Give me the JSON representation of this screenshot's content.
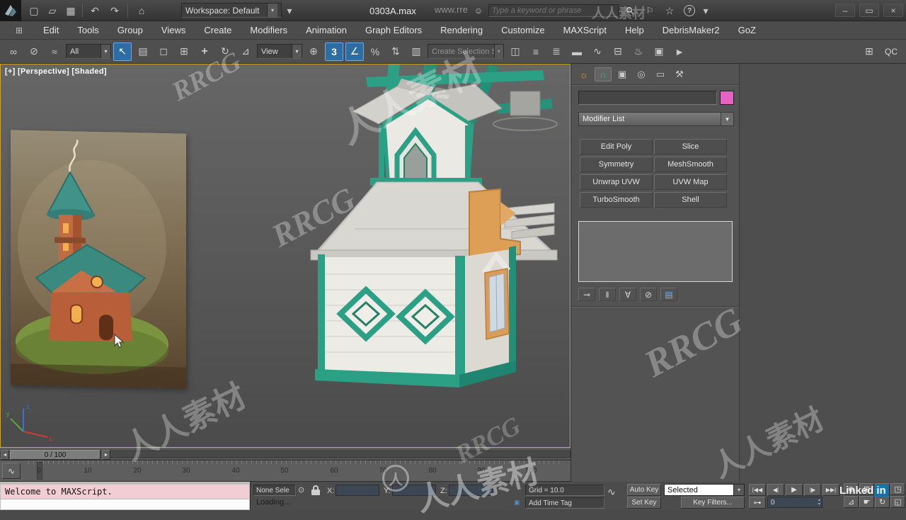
{
  "titlebar": {
    "workspace": "Workspace: Default",
    "document": "0303A.max",
    "search_placeholder": "Type a keyword or phrase"
  },
  "menus": [
    "Edit",
    "Tools",
    "Group",
    "Views",
    "Create",
    "Modifiers",
    "Animation",
    "Graph Editors",
    "Rendering",
    "Customize",
    "MAXScript",
    "Help",
    "DebrisMaker2",
    "GoZ"
  ],
  "toolbar": {
    "selection_filter": "All",
    "coord_system": "View",
    "named_selection": "Create Selection S",
    "qc": "QC"
  },
  "viewport": {
    "label": "[+] [Perspective] [Shaded]"
  },
  "command_panel": {
    "modifier_list": "Modifier List",
    "buttons": [
      "Edit Poly",
      "Slice",
      "Symmetry",
      "MeshSmooth",
      "Unwrap UVW",
      "UVW Map",
      "TurboSmooth",
      "Shell"
    ],
    "object_color": "#e562c5"
  },
  "timeline": {
    "slider": "0 / 100",
    "ticks": [
      "0",
      "10",
      "20",
      "30",
      "40",
      "50",
      "60",
      "70",
      "80",
      "90",
      "100"
    ]
  },
  "statusbar": {
    "listener_line": "Welcome to MAXScript.",
    "prompt": "Loading...",
    "selection": "None Sele",
    "x_label": "X:",
    "y_label": "Y:",
    "z_label": "Z:",
    "grid": "Grid = 10.0",
    "time_tag": "Add Time Tag",
    "auto_key": "Auto Key",
    "set_key": "Set Key",
    "key_mode": "Selected",
    "key_filters": "Key Filters...",
    "frame": "0"
  },
  "watermarks": {
    "brand_cn": "人人素材",
    "brand_en": "RRCG",
    "url": "www.rre",
    "linked": "Linked",
    "linked_in": "in",
    "circle_char": "人"
  },
  "icons": {
    "new_doc": "▢",
    "open_file": "▱",
    "save": "▦",
    "undo": "↶",
    "redo": "↷",
    "project": "⌂",
    "dropdown": "▾",
    "user": "☺",
    "search": "⚲",
    "flag": "⚐",
    "star": "☆",
    "help": "?",
    "minimize": "–",
    "maximize": "▭",
    "close": "×",
    "select_link": "∞",
    "unlink": "⊘",
    "bind": "≈",
    "select": "↖",
    "select_name": "▤",
    "rect_region": "◻",
    "crossing": "⊞",
    "move": "+",
    "rotate": "↻",
    "scale": "⊿",
    "manipulate": "⊕",
    "snap3": "3",
    "angle_snap": "∠",
    "percent_snap": "%",
    "spinner_snap": "⇅",
    "named_sets": "▥",
    "mirror": "◫",
    "align": "≡",
    "layers": "≣",
    "ribbon": "▬",
    "curve": "∿",
    "schematic": "⊟",
    "teapot": "♨",
    "frame_win": "▣",
    "render": "►",
    "pipeline": "⊞",
    "cp_create": "☼",
    "cp_modify": "∩",
    "cp_hierarchy": "▣",
    "cp_motion": "◎",
    "cp_display": "▭",
    "cp_utilities": "⚒",
    "pin_stack": "⊸",
    "end_result": "‖",
    "make_unique": "∀",
    "remove_mod": "⊘",
    "config_sets": "▤",
    "status_pin": "⊙",
    "tangent": "∿",
    "time_tag": "▣",
    "go_start": "|◀◀",
    "prev": "◀|",
    "play": "▶",
    "next": "|▶",
    "go_end": "▶▶|",
    "key_toggle": "⊶",
    "zoom": "⊕",
    "zoom_all": "⊞",
    "zoom_ext": "▣",
    "zoom_ext_all": "◳",
    "fov": "⊿",
    "pan": "☛",
    "orbit": "↻",
    "max_vp": "◱",
    "mini_curve": "∿",
    "arrow_left": "◄",
    "arrow_right": "►"
  }
}
